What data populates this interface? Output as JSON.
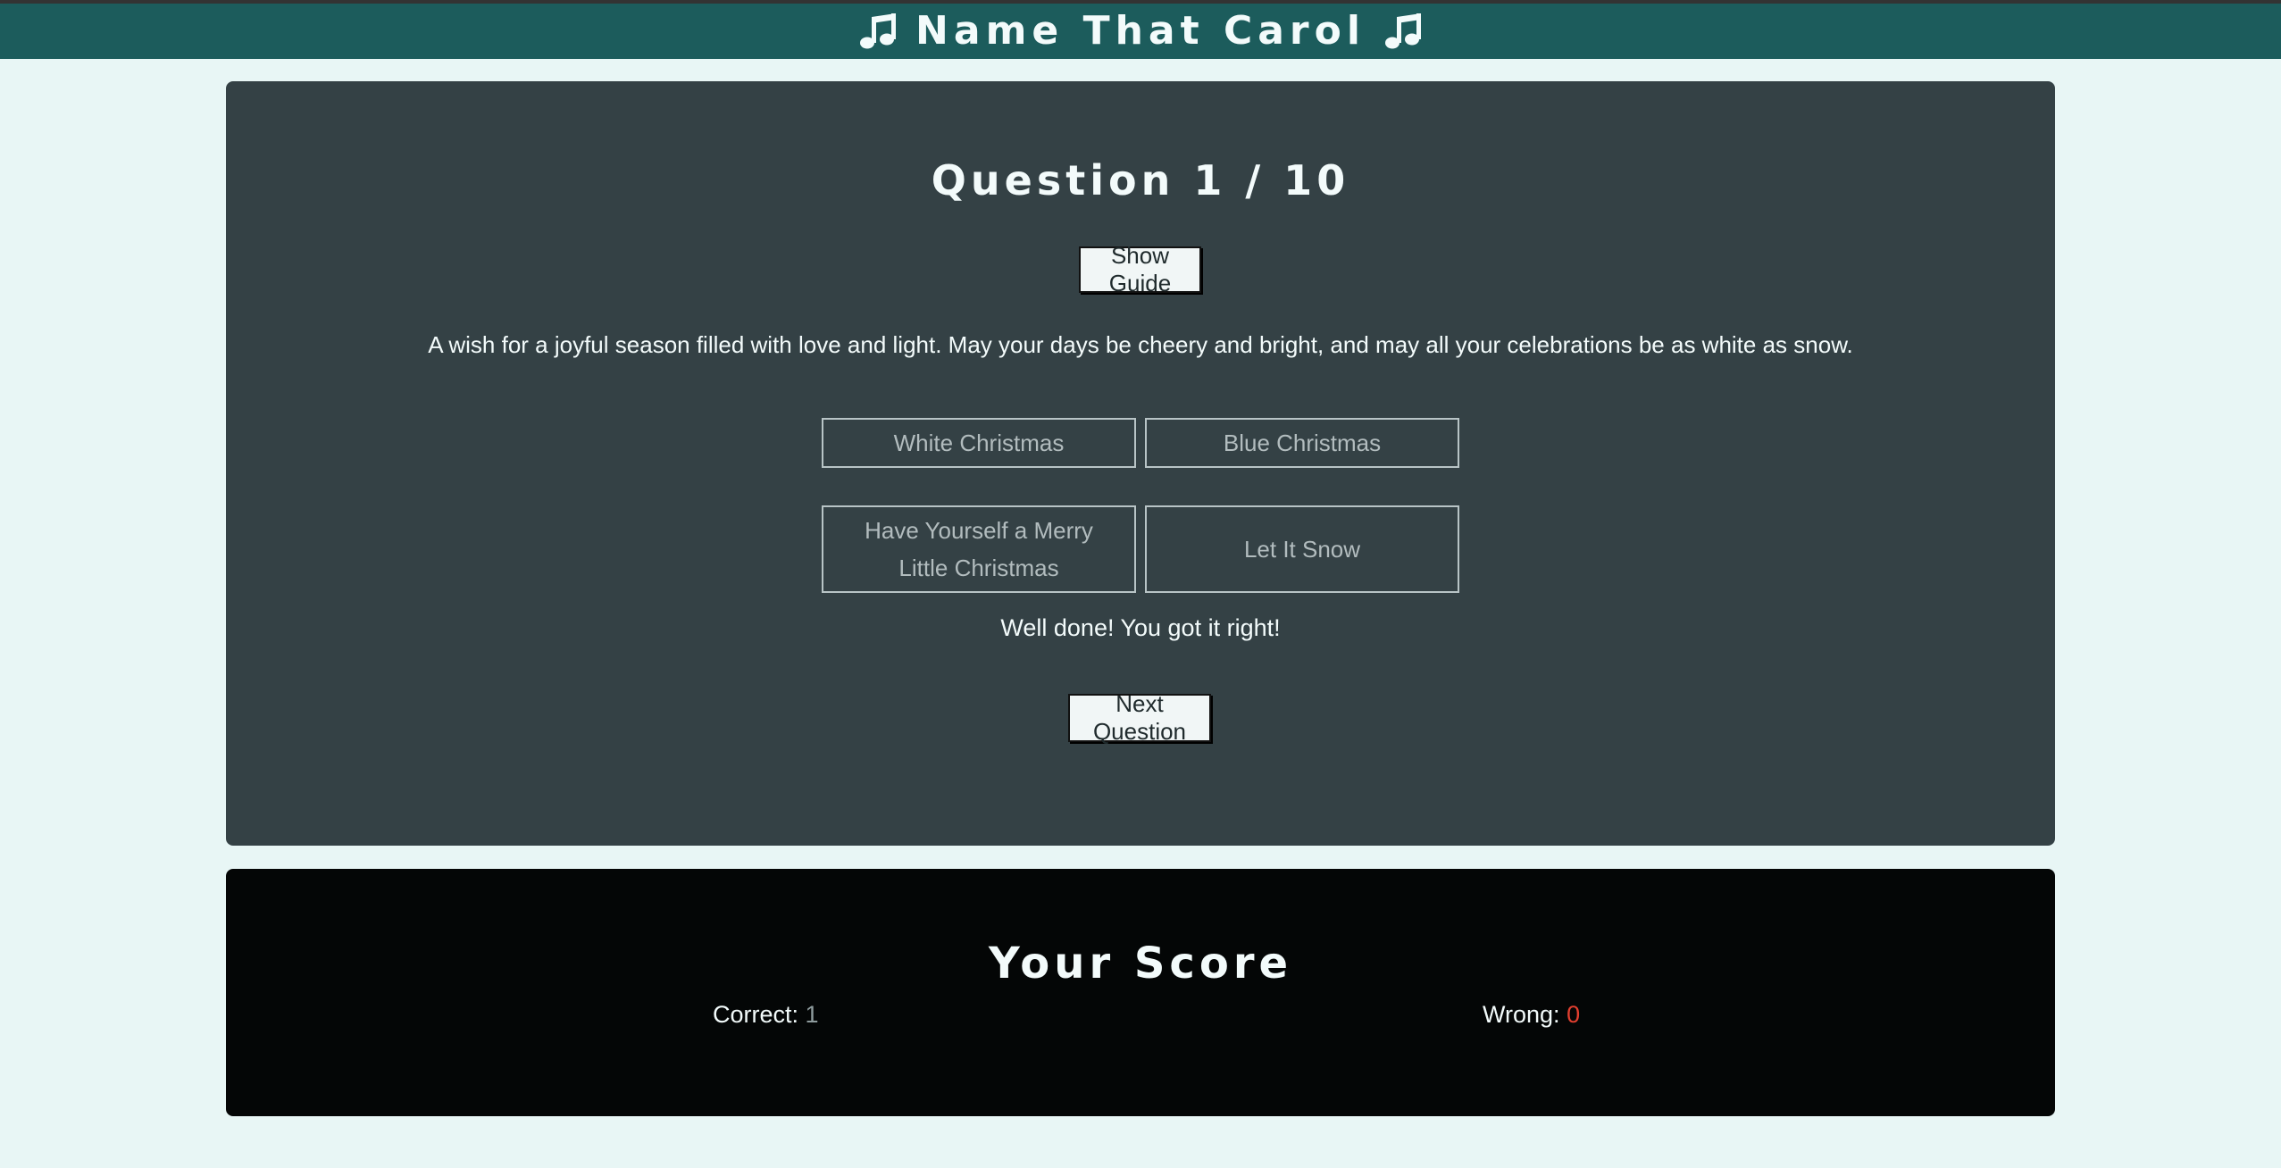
{
  "header": {
    "title": "Name That Carol",
    "left_icon": "music-note-icon",
    "right_icon": "music-note-icon"
  },
  "quiz": {
    "question_label": "Question 1 / 10",
    "guide_button_label": "Show Guide",
    "clue": "A wish for a joyful season filled with love and light. May your days be cheery and bright, and may all your celebrations be as white as snow.",
    "answers": [
      {
        "label": "White Christmas"
      },
      {
        "label": "Blue Christmas"
      },
      {
        "label": "Have Yourself a Merry Little Christmas"
      },
      {
        "label": "Let It Snow"
      }
    ],
    "feedback": "Well done! You got it right!",
    "next_button_label": "Next Question"
  },
  "score": {
    "title": "Your Score",
    "correct_label": "Correct:",
    "correct_value": "1",
    "wrong_label": "Wrong:",
    "wrong_value": "0"
  },
  "colors": {
    "header_bg": "#1c5c5c",
    "page_bg": "#e8f6f5",
    "quiz_bg": "#344145",
    "score_bg": "#040606",
    "wrong_accent": "#e23f2f"
  }
}
